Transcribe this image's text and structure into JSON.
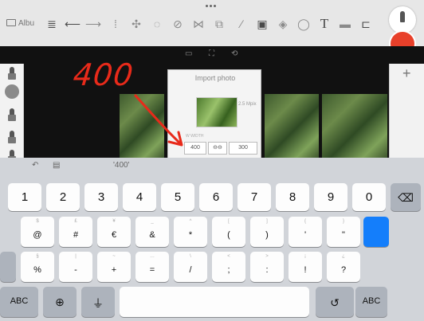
{
  "toolbar": {
    "album_label": "Albu",
    "text_tool_label": "T"
  },
  "handwriting": "400",
  "dialog": {
    "title": "Import photo",
    "size_label": "2.5 Mpix",
    "dim_label": "W  WIDTH",
    "width_value": "400",
    "link_symbol": "⊖⊖",
    "height_value": "300"
  },
  "keyboard": {
    "suggestion": "'400'",
    "number_row": [
      "1",
      "2",
      "3",
      "4",
      "5",
      "6",
      "7",
      "8",
      "9",
      "0"
    ],
    "symbol_row_1": [
      {
        "hint": "$",
        "main": "@"
      },
      {
        "hint": "£",
        "main": "#"
      },
      {
        "hint": "¥",
        "main": "€"
      },
      {
        "hint": "_",
        "main": "&"
      },
      {
        "hint": "^",
        "main": "*"
      },
      {
        "hint": "[",
        "main": "("
      },
      {
        "hint": "]",
        "main": ")"
      },
      {
        "hint": "{",
        "main": "'"
      },
      {
        "hint": "}",
        "main": "\""
      }
    ],
    "symbol_row_2": [
      {
        "hint": "§",
        "main": "%"
      },
      {
        "hint": "|",
        "main": "-"
      },
      {
        "hint": "~",
        "main": "+"
      },
      {
        "hint": "…",
        "main": "="
      },
      {
        "hint": "\\",
        "main": "/"
      },
      {
        "hint": "<",
        "main": ";"
      },
      {
        "hint": ">",
        "main": ":"
      },
      {
        "hint": "¡",
        "main": "!"
      },
      {
        "hint": "¿",
        "main": "?"
      }
    ],
    "abc_label": "ABC",
    "abc_right_label": "ABC"
  },
  "colors": {
    "accent_red": "#e8402a",
    "keyboard_blue": "#147efb"
  }
}
